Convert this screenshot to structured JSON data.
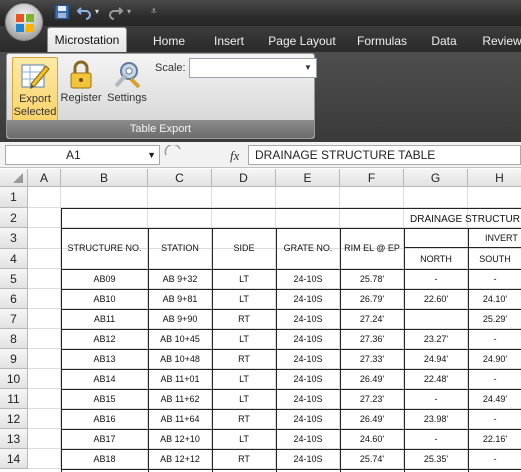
{
  "colors": {
    "accent": "#fbd46b",
    "ribbon_dark": "#3a3a3a",
    "tab_active": "#ececec"
  },
  "ribbon": {
    "tabs": [
      {
        "label": "Microstation",
        "active": true
      },
      {
        "label": "Home"
      },
      {
        "label": "Insert"
      },
      {
        "label": "Page Layout"
      },
      {
        "label": "Formulas"
      },
      {
        "label": "Data"
      },
      {
        "label": "Review"
      }
    ],
    "group_title": "Table Export",
    "buttons": {
      "export_line1": "Export",
      "export_line2": "Selected",
      "register": "Register",
      "settings": "Settings"
    },
    "scale_label": "Scale:",
    "scale_value": ""
  },
  "formula_bar": {
    "name_box": "A1",
    "fx_label": "fx",
    "content": "DRAINAGE STRUCTURE TABLE"
  },
  "sheet": {
    "columns": [
      "A",
      "B",
      "C",
      "D",
      "E",
      "F",
      "G",
      "H"
    ],
    "rows": [
      "1",
      "2",
      "3",
      "4",
      "5",
      "6",
      "7",
      "8",
      "9",
      "10",
      "11",
      "12",
      "13",
      "14"
    ],
    "title": "DRAINAGE STRUCTUR",
    "headers": {
      "structure_no": "STRUCTURE NO.",
      "station": "STATION",
      "side": "SIDE",
      "grate_no": "GRATE NO.",
      "rim_el": "RIM EL @ EP",
      "invert": "INVERT",
      "north": "NORTH",
      "south": "SOUTH"
    },
    "data": [
      [
        "AB09",
        "AB 9+32",
        "LT",
        "24-10S",
        "25.78'",
        "-",
        "-"
      ],
      [
        "AB10",
        "AB 9+81",
        "LT",
        "24-10S",
        "26.79'",
        "22.60'",
        "24.10'"
      ],
      [
        "AB11",
        "AB 9+90",
        "RT",
        "24-10S",
        "27.24'",
        "",
        "25.29'"
      ],
      [
        "AB12",
        "AB 10+45",
        "LT",
        "24-10S",
        "27.36'",
        "23.27'",
        "-"
      ],
      [
        "AB13",
        "AB 10+48",
        "RT",
        "24-10S",
        "27.33'",
        "24.94'",
        "24.90'"
      ],
      [
        "AB14",
        "AB 11+01",
        "LT",
        "24-10S",
        "26.49'",
        "22.48'",
        "-"
      ],
      [
        "AB15",
        "AB 11+62",
        "LT",
        "24-10S",
        "27.23'",
        "-",
        "24.49'"
      ],
      [
        "AB16",
        "AB 11+64",
        "RT",
        "24-10S",
        "26.49'",
        "23.98'",
        "-"
      ],
      [
        "AB17",
        "AB 12+10",
        "LT",
        "24-10S",
        "24.60'",
        "-",
        "22.16'"
      ],
      [
        "AB18",
        "AB 12+12",
        "RT",
        "24-10S",
        "25.74'",
        "25.35'",
        "-"
      ]
    ]
  }
}
